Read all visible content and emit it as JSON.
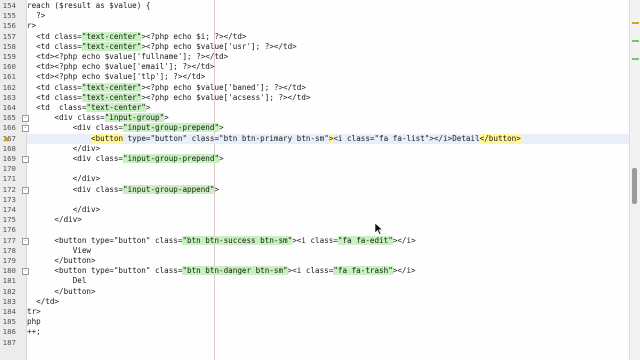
{
  "editor": {
    "lines": [
      {
        "num": "154",
        "segments": [
          {
            "t": "reach ($result as $value) {",
            "c": "plain"
          }
        ]
      },
      {
        "num": "155",
        "segments": [
          {
            "t": "  ?>",
            "c": "plain"
          }
        ]
      },
      {
        "num": "156",
        "segments": [
          {
            "t": "r>",
            "c": "plain"
          }
        ]
      },
      {
        "num": "157",
        "segments": [
          {
            "t": "  <td class=",
            "c": "plain"
          },
          {
            "t": "\"text-center\"",
            "c": "hl"
          },
          {
            "t": "><?php echo $i; ?></td>",
            "c": "plain"
          }
        ]
      },
      {
        "num": "158",
        "segments": [
          {
            "t": "  <td class=",
            "c": "plain"
          },
          {
            "t": "\"text-center\"",
            "c": "hl"
          },
          {
            "t": "><?php echo $value['usr']; ?></td>",
            "c": "plain"
          }
        ]
      },
      {
        "num": "159",
        "segments": [
          {
            "t": "  <td><?php echo $value['fullname']; ?></td>",
            "c": "plain"
          }
        ]
      },
      {
        "num": "160",
        "segments": [
          {
            "t": "  <td><?php echo $value['email']; ?></td>",
            "c": "plain"
          }
        ]
      },
      {
        "num": "161",
        "segments": [
          {
            "t": "  <td><?php echo $value['tlp']; ?></td>",
            "c": "plain"
          }
        ]
      },
      {
        "num": "162",
        "segments": [
          {
            "t": "  <td class=",
            "c": "plain"
          },
          {
            "t": "\"text-center\"",
            "c": "hl"
          },
          {
            "t": "><?php echo $value['baned']; ?></td>",
            "c": "plain"
          }
        ]
      },
      {
        "num": "163",
        "segments": [
          {
            "t": "  <td class=",
            "c": "plain"
          },
          {
            "t": "\"text-center\"",
            "c": "hl"
          },
          {
            "t": "><?php echo $value['acsess']; ?></td>",
            "c": "plain"
          }
        ]
      },
      {
        "num": "164",
        "segments": [
          {
            "t": "  <td  class=",
            "c": "plain"
          },
          {
            "t": "\"text-center\"",
            "c": "hl"
          },
          {
            "t": ">",
            "c": "plain"
          }
        ]
      },
      {
        "num": "165",
        "segments": [
          {
            "t": "      <div class=",
            "c": "plain"
          },
          {
            "t": "\"input-group\"",
            "c": "hl"
          },
          {
            "t": ">",
            "c": "plain"
          }
        ]
      },
      {
        "num": "166",
        "segments": [
          {
            "t": "          <div class=",
            "c": "plain"
          },
          {
            "t": "\"input-group-prepend\"",
            "c": "hl"
          },
          {
            "t": ">",
            "c": "plain"
          }
        ]
      },
      {
        "num": "167",
        "segments": [
          {
            "t": "              ",
            "c": "plain"
          },
          {
            "t": "<button",
            "c": "tag"
          },
          {
            "t": " type=\"button\" class=\"btn btn-primary btn-sm\"",
            "c": "plain"
          },
          {
            "t": ">",
            "c": "tag"
          },
          {
            "t": "<i class=\"fa fa-list\"></i>Detail",
            "c": "plain"
          },
          {
            "t": "</button>",
            "c": "tag"
          }
        ]
      },
      {
        "num": "168",
        "segments": [
          {
            "t": "          </div>",
            "c": "plain"
          }
        ]
      },
      {
        "num": "169",
        "segments": [
          {
            "t": "          <div class=",
            "c": "plain"
          },
          {
            "t": "\"input-group-prepend\"",
            "c": "hl"
          },
          {
            "t": ">",
            "c": "plain"
          }
        ]
      },
      {
        "num": "170",
        "segments": [
          {
            "t": "",
            "c": "plain"
          }
        ]
      },
      {
        "num": "171",
        "segments": [
          {
            "t": "          </div>",
            "c": "plain"
          }
        ]
      },
      {
        "num": "172",
        "segments": [
          {
            "t": "          <div class=",
            "c": "plain"
          },
          {
            "t": "\"input-group-append\"",
            "c": "hl"
          },
          {
            "t": ">",
            "c": "plain"
          }
        ]
      },
      {
        "num": "173",
        "segments": [
          {
            "t": "",
            "c": "plain"
          }
        ]
      },
      {
        "num": "174",
        "segments": [
          {
            "t": "          </div>",
            "c": "plain"
          }
        ]
      },
      {
        "num": "175",
        "segments": [
          {
            "t": "      </div>",
            "c": "plain"
          }
        ]
      },
      {
        "num": "176",
        "segments": [
          {
            "t": "",
            "c": "plain"
          }
        ]
      },
      {
        "num": "177",
        "segments": [
          {
            "t": "      <button type=\"button\" class=",
            "c": "plain"
          },
          {
            "t": "\"btn btn-success btn-sm\"",
            "c": "hl"
          },
          {
            "t": "><i class=",
            "c": "plain"
          },
          {
            "t": "\"fa fa-edit\"",
            "c": "hl"
          },
          {
            "t": "></i>",
            "c": "plain"
          }
        ]
      },
      {
        "num": "178",
        "segments": [
          {
            "t": "          View",
            "c": "plain"
          }
        ]
      },
      {
        "num": "179",
        "segments": [
          {
            "t": "      </button>",
            "c": "plain"
          }
        ]
      },
      {
        "num": "180",
        "segments": [
          {
            "t": "      <button type=\"button\" class=",
            "c": "plain"
          },
          {
            "t": "\"btn btn-danger btn-sm\"",
            "c": "hl"
          },
          {
            "t": "><i class=",
            "c": "plain"
          },
          {
            "t": "\"fa fa-trash\"",
            "c": "hl"
          },
          {
            "t": "></i>",
            "c": "plain"
          }
        ]
      },
      {
        "num": "181",
        "segments": [
          {
            "t": "          Del",
            "c": "plain"
          }
        ]
      },
      {
        "num": "182",
        "segments": [
          {
            "t": "      </button>",
            "c": "plain"
          }
        ]
      },
      {
        "num": "183",
        "segments": [
          {
            "t": "  </td>",
            "c": "plain"
          }
        ]
      },
      {
        "num": "184",
        "segments": [
          {
            "t": "tr>",
            "c": "plain"
          }
        ]
      },
      {
        "num": "185",
        "segments": [
          {
            "t": "php",
            "c": "plain"
          }
        ]
      },
      {
        "num": "186",
        "segments": [
          {
            "t": "++;",
            "c": "plain"
          }
        ]
      },
      {
        "num": "187",
        "segments": [
          {
            "t": "",
            "c": "plain"
          }
        ]
      }
    ],
    "current_line": "167",
    "colors": {
      "highlight": "#c9f0c0",
      "tag_match": "#fff59a",
      "background": "#fefefe"
    }
  }
}
